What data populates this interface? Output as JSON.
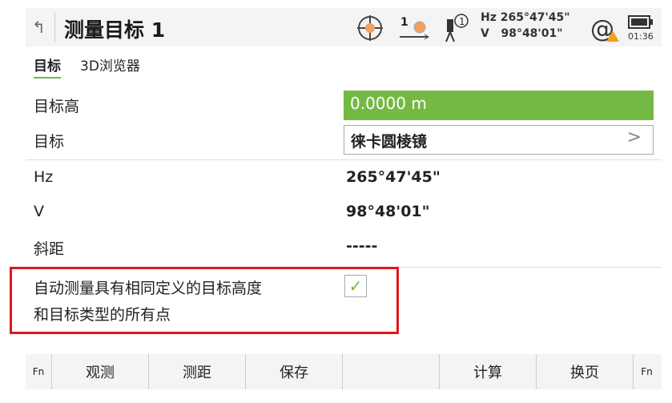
{
  "header": {
    "title": "测量目标 1",
    "hz": "Hz 265°47'45\"",
    "v": "V   98°48'01\"",
    "time": "01:36",
    "face_indicator": "1",
    "prism_count": "1"
  },
  "tabs": [
    {
      "label": "目标",
      "active": true
    },
    {
      "label": "3D浏览器",
      "active": false
    }
  ],
  "fields": {
    "target_height": {
      "label": "目标高",
      "value": "0.0000 m"
    },
    "target": {
      "label": "目标",
      "value": "徕卡圆棱镜"
    },
    "hz": {
      "label": "Hz",
      "value": "265°47'45\""
    },
    "v": {
      "label": "V",
      "value": "98°48'01\""
    },
    "slope_distance": {
      "label": "斜距",
      "value": "-----"
    }
  },
  "auto_measure": {
    "label_line1": "自动测量具有相同定义的目标高度",
    "label_line2": "和目标类型的所有点",
    "checked": true
  },
  "softkeys": [
    "Fn",
    "观测",
    "测距",
    "保存",
    "",
    "计算",
    "换页",
    "Fn"
  ],
  "colors": {
    "accent": "#74b944",
    "highlight": "#e3161b",
    "warning": "#f0a020"
  }
}
